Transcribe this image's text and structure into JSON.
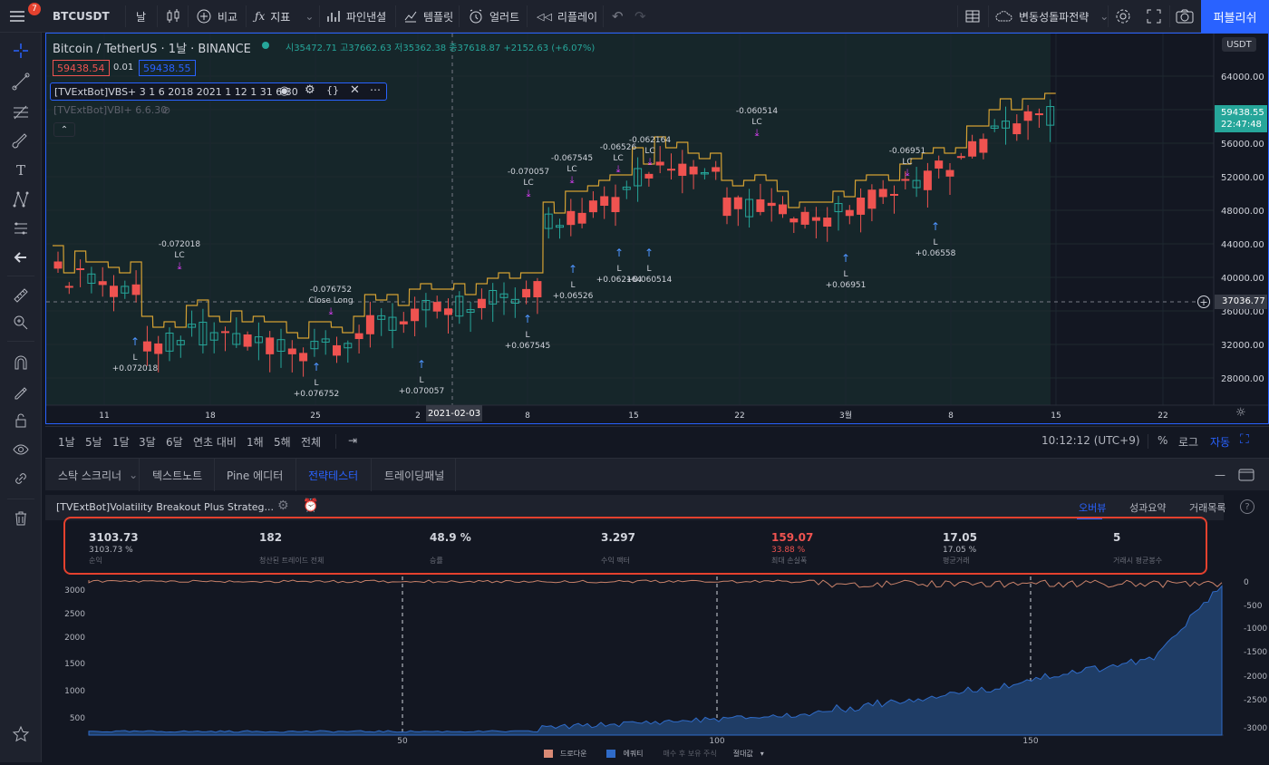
{
  "topbar": {
    "notif_count": "7",
    "symbol": "BTCUSDT",
    "interval": "날",
    "compare": "비교",
    "indicators": "지표",
    "pine": "파인낸셜",
    "templates": "템플릿",
    "alert": "얼러트",
    "replay": "리플레이",
    "layout": "변동성돌파전략",
    "publish": "퍼블리쉬"
  },
  "chart": {
    "title": "Bitcoin / TetherUS · 1날 · BINANCE",
    "ohlc": "시35472.71 고37662.63 저35362.38 종37618.87 +2152.63 (+6.07%)",
    "bid": "59438.54",
    "spread": "0.01",
    "ask": "59438.55",
    "indicator1": "[TVExtBot]VBS+ 3 1 6 2018 2021 1 12 1 31 6 30",
    "indicator2": "[TVExtBot]VBI+ 6.6.30",
    "currency": "USDT",
    "current_price": "59438.55",
    "countdown": "22:47:48",
    "crosshair_price": "37036.77",
    "crosshair_date": "2021-02-03",
    "y_ticks": [
      "64000.00",
      "60000.00",
      "56000.00",
      "52000.00",
      "48000.00",
      "44000.00",
      "40000.00",
      "36000.00",
      "32000.00",
      "28000.00"
    ],
    "x_ticks": [
      "11",
      "18",
      "25",
      "2",
      "8",
      "15",
      "22",
      "3월",
      "8",
      "15",
      "22"
    ],
    "annotations": [
      {
        "text": "-0.072018"
      },
      {
        "text": "LC"
      },
      {
        "text": "-0.076752"
      },
      {
        "text": "Close Long"
      },
      {
        "text": "-0.070057"
      },
      {
        "text": "LC"
      },
      {
        "text": "-0.067545"
      },
      {
        "text": "LC"
      },
      {
        "text": "-0.06526"
      },
      {
        "text": "LC"
      },
      {
        "text": "-0.062164"
      },
      {
        "text": "LC"
      },
      {
        "text": "-0.060514"
      },
      {
        "text": "LC"
      },
      {
        "text": "-0.06951"
      },
      {
        "text": "LC"
      },
      {
        "text": "L"
      },
      {
        "text": "+0.072018"
      },
      {
        "text": "L"
      },
      {
        "text": "+0.076752"
      },
      {
        "text": "L"
      },
      {
        "text": "+0.070057"
      },
      {
        "text": "L"
      },
      {
        "text": "+0.067545"
      },
      {
        "text": "L"
      },
      {
        "text": "+0.06526"
      },
      {
        "text": "L"
      },
      {
        "text": "+0.062164"
      },
      {
        "text": "L"
      },
      {
        "text": "+0.060514"
      },
      {
        "text": "L"
      },
      {
        "text": "+0.06951"
      },
      {
        "text": "L"
      },
      {
        "text": "+0.06558"
      }
    ]
  },
  "timeframes": [
    "1날",
    "5날",
    "1달",
    "3달",
    "6달",
    "연초 대비",
    "1해",
    "5해",
    "전체"
  ],
  "clock": "10:12:12 (UTC+9)",
  "scale_opts": [
    "%",
    "로그",
    "자동"
  ],
  "panel": {
    "tabs": [
      "스탁 스크리너",
      "텍스트노트",
      "Pine 에디터",
      "전략테스터",
      "트레이딩패널"
    ],
    "strategy_name": "[TVExtBot]Volatility Breakout Plus Strateg...",
    "views": [
      "오버뷰",
      "성과요약",
      "거래목록"
    ]
  },
  "stats": [
    {
      "value": "3103.73",
      "sub": "3103.73 %",
      "label": "순익"
    },
    {
      "value": "182",
      "sub": "",
      "label": "청산된 트레이드 전체"
    },
    {
      "value": "48.9 %",
      "sub": "",
      "label": "승률"
    },
    {
      "value": "3.297",
      "sub": "",
      "label": "수익 팩터"
    },
    {
      "value": "159.07",
      "sub": "33.88 %",
      "label": "최대 손실폭"
    },
    {
      "value": "17.05",
      "sub": "17.05 %",
      "label": "평균거래"
    },
    {
      "value": "5",
      "sub": "",
      "label": "거래시 평균봉수"
    }
  ],
  "equity": {
    "left_ticks": [
      "3000",
      "2500",
      "2000",
      "1500",
      "1000",
      "500"
    ],
    "right_ticks": [
      "0",
      "-500",
      "-1000",
      "-1500",
      "-2000",
      "-2500",
      "-3000"
    ],
    "x_ticks": [
      "50",
      "100",
      "150"
    ],
    "legend": [
      "드로다운",
      "에쿼티",
      "매수 후 보유 주식",
      "절대값"
    ]
  },
  "colors": {
    "accent": "#2962ff",
    "up": "#26a69a",
    "down": "#ef5350",
    "highlight": "#e4412e"
  }
}
